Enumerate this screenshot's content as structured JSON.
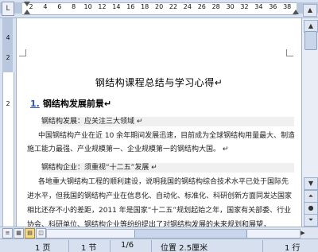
{
  "ruler": {
    "top_ticks": [
      "2",
      "4",
      "6",
      "8",
      "10",
      "12",
      "14",
      "16",
      "18",
      "20",
      "22",
      "24",
      "26",
      "28",
      "30",
      "32",
      "34",
      "36",
      "38"
    ],
    "left_ticks": [
      "4",
      "2",
      "2"
    ],
    "tab_marker": "L"
  },
  "document": {
    "title": "钢结构课程总结与学习心得↵",
    "heading_number": "1.",
    "heading_text": "钢结构发展前景↵",
    "paragraphs": [
      "钢结构发展：应关注三大领域 ↵",
      "中国钢结构产业在近 10 余年期间发展迅速，目前成为全球钢结构用量最大、制造",
      "施工能力最强、产业规模第一、企业规模第一的钢结构大国。 ↵",
      "钢结构企业：须重视“十二五”发展 ↵",
      "各地重大钢结构工程的顺利建设，说明我国的钢结构综合技术水平已处于国际先",
      "进水平，但我国的钢结构产业在信息化、自动化、标准化、科研创新方面同发达国家",
      "相比还存不小的差距，2011 年是国家“十二五”规划起始之年，国家有关部委、行业",
      "协会、科研单位、钢结构企业等纷纷提出了对钢结构发展的未来规划和展望，"
    ]
  },
  "view_buttons": [
    "≡",
    "▦",
    "▤",
    "▭",
    "◫"
  ],
  "status": {
    "page": "1 页",
    "section": "1 节",
    "page_of": "1/6",
    "position": "位置 2.5厘米",
    "line": "1 行"
  }
}
